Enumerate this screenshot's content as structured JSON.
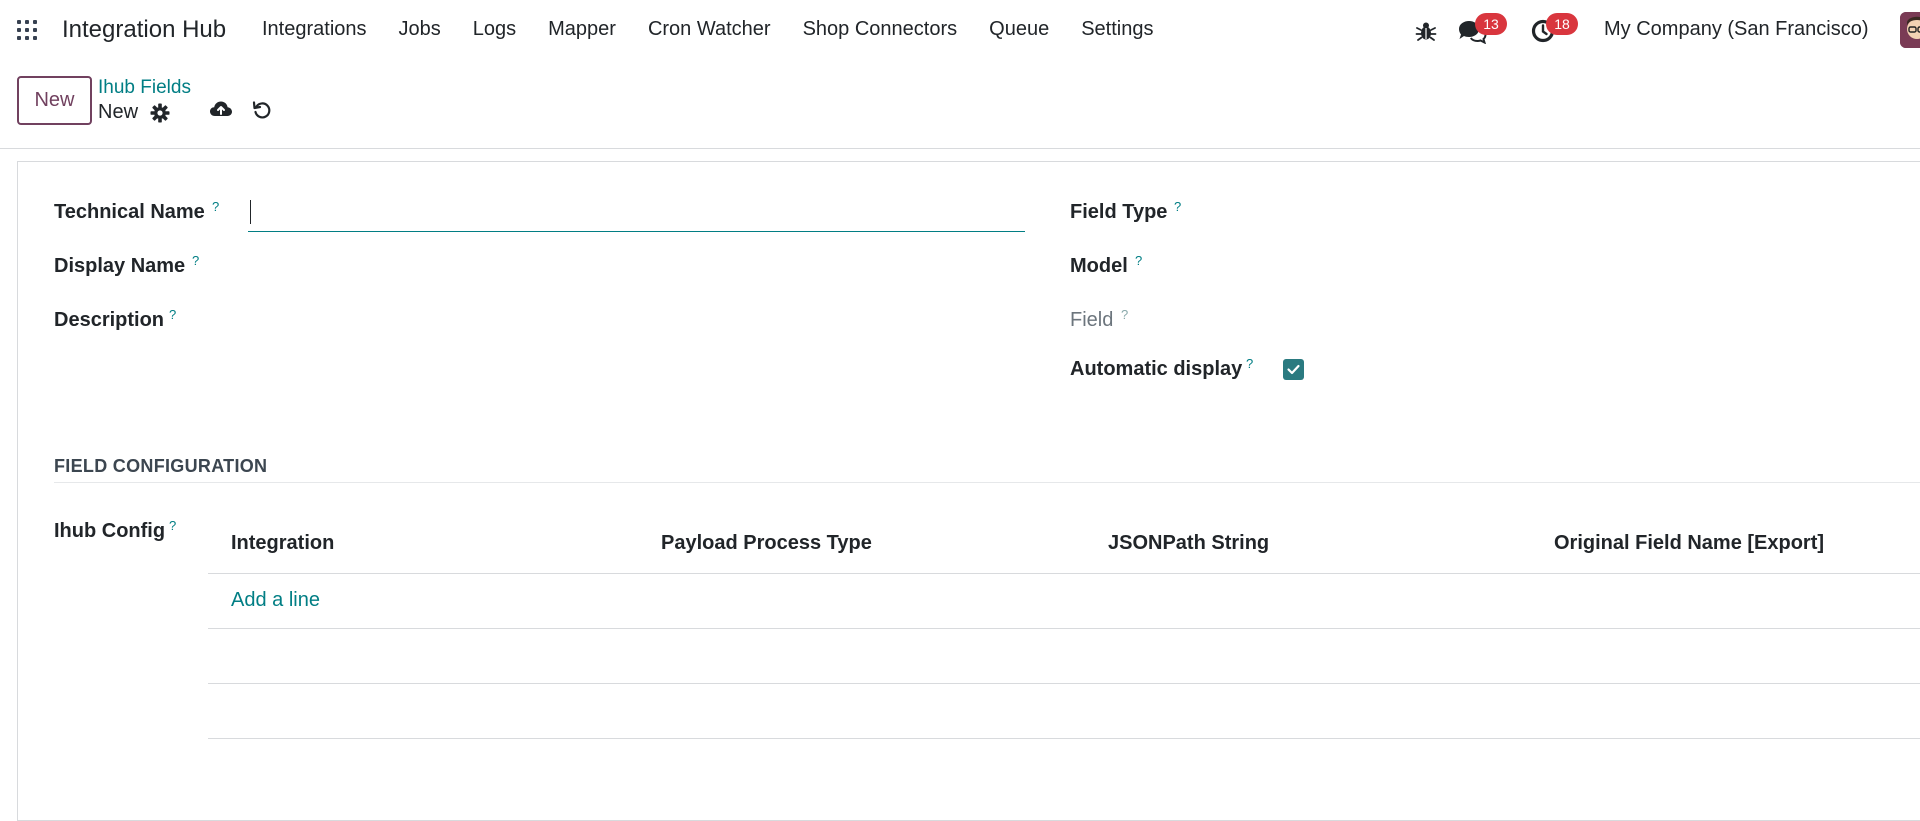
{
  "navbar": {
    "brand": "Integration Hub",
    "menu": [
      "Integrations",
      "Jobs",
      "Logs",
      "Mapper",
      "Cron Watcher",
      "Shop Connectors",
      "Queue",
      "Settings"
    ],
    "messages_count": "13",
    "activities_count": "18",
    "company": "My Company (San Francisco)",
    "icons": [
      "apps-grid-icon",
      "bug-icon",
      "chat-icon",
      "clock-icon"
    ]
  },
  "control_panel": {
    "new_label": "New",
    "breadcrumb_parent": "Ihub Fields",
    "breadcrumb_current": "New",
    "icons": [
      "gear-icon",
      "cloud-upload-icon",
      "discard-icon"
    ]
  },
  "form": {
    "technical_name_label": "Technical Name",
    "technical_name_value": "",
    "display_name_label": "Display Name",
    "description_label": "Description",
    "field_type_label": "Field Type",
    "model_label": "Model",
    "field_label": "Field",
    "automatic_display_label": "Automatic display",
    "automatic_display_checked": true,
    "help_mark": "?",
    "section_title": "FIELD CONFIGURATION",
    "ihub_config_label": "Ihub Config",
    "table": {
      "columns": [
        "Integration",
        "Payload Process Type",
        "JSONPath String",
        "Original Field Name [Export]"
      ],
      "add_line": "Add a line"
    }
  },
  "colors": {
    "accent": "#017e84",
    "brand_button": "#71415f",
    "badge": "#d9363e",
    "checkbox": "#2a7a80"
  }
}
